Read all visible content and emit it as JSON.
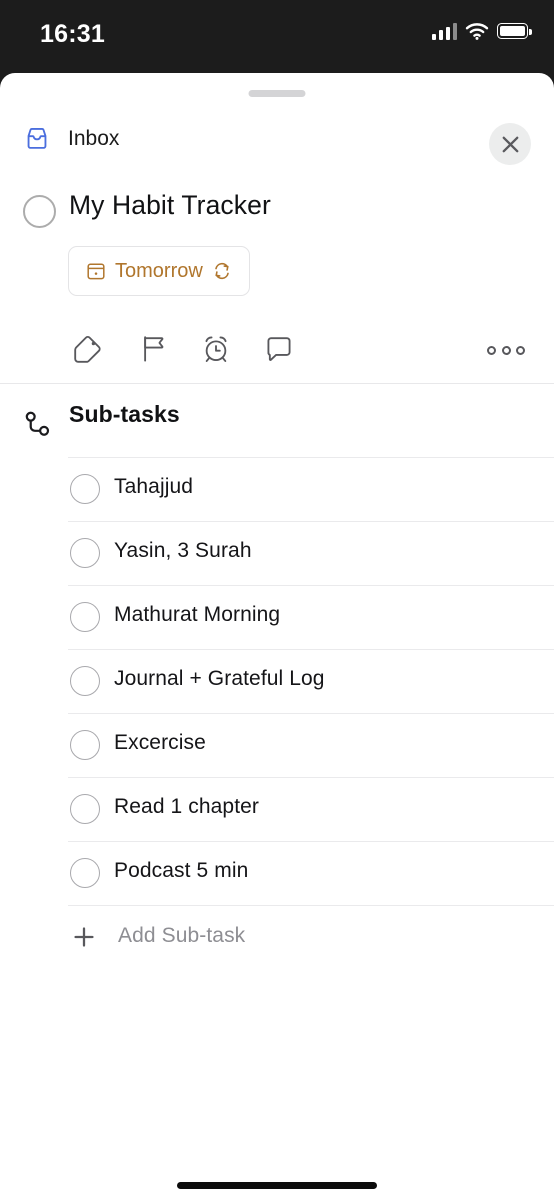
{
  "status_bar": {
    "time": "16:31",
    "signal_icon": "cellular-signal-icon",
    "wifi_icon": "wifi-icon",
    "battery_icon": "battery-full-icon"
  },
  "sheet": {
    "grabber": "drag-handle"
  },
  "header": {
    "project_icon": "inbox-icon",
    "project_label": "Inbox",
    "close_label": "close-icon"
  },
  "task": {
    "checkbox": "task-checkbox",
    "title": "My Habit Tracker",
    "date_chip": {
      "calendar_icon": "calendar-icon",
      "label": "Tomorrow",
      "repeat_icon": "repeat-icon",
      "color": "#b0762d"
    },
    "actions": [
      {
        "name": "label-tag-icon"
      },
      {
        "name": "priority-flag-icon"
      },
      {
        "name": "reminder-alarm-icon"
      },
      {
        "name": "comment-icon"
      }
    ],
    "more_label": "more-options-icon"
  },
  "subtasks_section": {
    "icon": "sub-task-branch-icon",
    "title": "Sub-tasks",
    "items": [
      {
        "label": "Tahajjud",
        "completed": false
      },
      {
        "label": "Yasin, 3 Surah",
        "completed": false
      },
      {
        "label": "Mathurat Morning",
        "completed": false
      },
      {
        "label": "Journal + Grateful Log",
        "completed": false
      },
      {
        "label": "Excercise",
        "completed": false
      },
      {
        "label": "Read 1 chapter",
        "completed": false
      },
      {
        "label": "Podcast 5 min",
        "completed": false
      }
    ],
    "add_label": "Add Sub-task",
    "add_icon": "plus-icon"
  },
  "colors": {
    "accent_inbox": "#4b6ede",
    "accent_date": "#b0762d",
    "text_primary": "#151518",
    "text_muted": "#8e8e93",
    "divider": "#e8e8ea",
    "status_bar_bg": "#1c1c1c"
  }
}
